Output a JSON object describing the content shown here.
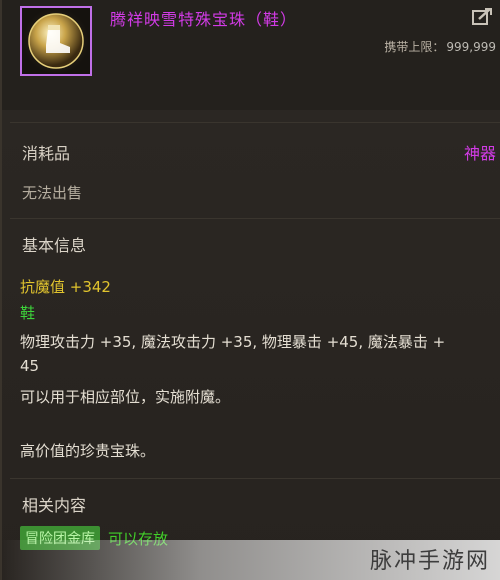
{
  "item": {
    "name": "腾祥映雪特殊宝珠（鞋）",
    "icon": "boot-orb-icon",
    "carry_limit_label": "携带上限：",
    "carry_limit_value": "999,999"
  },
  "type": "消耗品",
  "grade": "神器",
  "trade": "无法出售",
  "basic_info": {
    "title": "基本信息",
    "magic_resist": "抗魔值 +342",
    "slot": "鞋",
    "stats_line1": "物理攻击力 +35, 魔法攻击力 +35, 物理暴击 +45, 魔法暴击 +",
    "stats_line2": "45",
    "usage": "可以用于相应部位，实施附魔。",
    "description": "高价值的珍贵宝珠。"
  },
  "related": {
    "title": "相关内容",
    "badge": "冒险团金库",
    "note": "可以存放"
  },
  "watermark": "脉冲手游网",
  "colors": {
    "epic_purple": "#d23be6",
    "stat_yellow": "#e1c42e",
    "slot_green": "#3dd23a",
    "badge_green": "#3c8f32"
  }
}
